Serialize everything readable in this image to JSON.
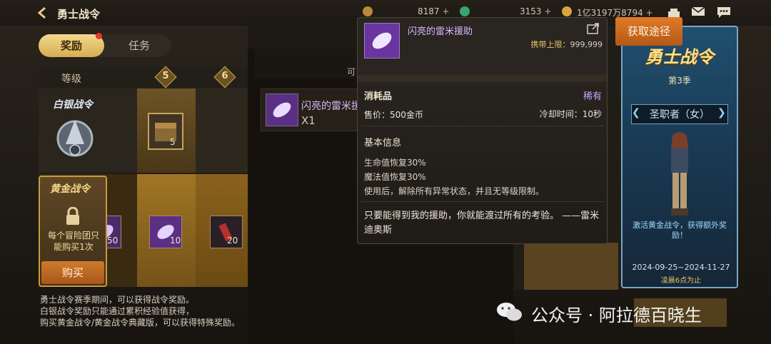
{
  "header": {
    "title": "勇士战令",
    "back_icon": "back-arrow-icon"
  },
  "resources": [
    {
      "icon": "coin-icon-1",
      "value": "8187",
      "plus": "+"
    },
    {
      "icon": "gem-icon",
      "value": "3153",
      "plus": "+"
    },
    {
      "icon": "gold-coin-icon",
      "value": "1亿3197万8794",
      "plus": "+"
    }
  ],
  "top_right_icons": [
    "cake-icon",
    "mail-icon",
    "chat-icon"
  ],
  "tabs": {
    "reward": "奖励",
    "task": "任务"
  },
  "levels": {
    "label": "等级",
    "numbers": [
      "5",
      "6"
    ]
  },
  "silver": {
    "label": "白银战令",
    "chest_count": "5"
  },
  "gold": {
    "label": "黄金战令",
    "limit_text": "每个冒险团只能购买1次",
    "buy_button": "购买",
    "item_counts": [
      "50",
      "10",
      "20"
    ]
  },
  "footer_notes": [
    "勇士战令赛季期间，可以获得战令奖励。",
    "白银战令奖励只能通过累积经验值获得，",
    "购买黄金战令/黄金战令典藏版，可以获得特殊奖励。"
  ],
  "middle_panel": {
    "sub_header": "可",
    "item_name": "闪亮的雷米援",
    "item_qty": "X1"
  },
  "obtain_button": "获取途径",
  "banner": {
    "title": "勇士战令",
    "season": "第3季",
    "class_name": "圣职者（女）",
    "desc": "激活黄金战令，获得额外奖励！",
    "dates": "2024-09-25~2024-11-27",
    "deadline": "凌晨6点为止"
  },
  "tooltip": {
    "name": "闪亮的雷米援助",
    "carry_label": "携带上限：",
    "carry_value": "999,999",
    "type": "消耗品",
    "rarity": "稀有",
    "price": "售价：500金币",
    "cooldown": "冷却时间：10秒",
    "basic_info_label": "基本信息",
    "effects": [
      "生命值恢复30%",
      "魔法值恢复30%",
      "使用后，解除所有异常状态，并且无等级限制。"
    ],
    "quote": "只要能得到我的援助，你就能渡过所有的考验。 ——雷米迪奥斯"
  },
  "watermark": {
    "text": "公众号 · 阿拉德百晓生"
  },
  "colors": {
    "accent_gold": "#d6ad4f",
    "button_orange": "#d07a2d",
    "rarity_purple": "#c8a4ff"
  }
}
